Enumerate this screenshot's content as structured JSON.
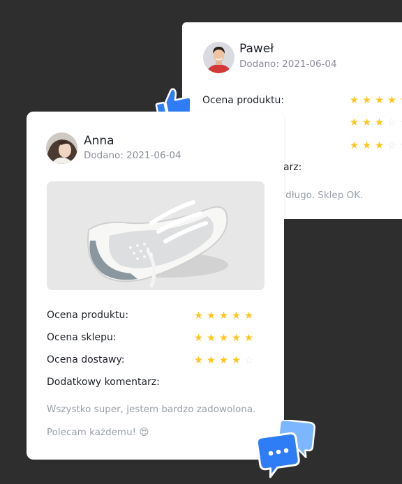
{
  "back_review": {
    "name": "Paweł",
    "date": "Dodano: 2021-06-04",
    "ratings": [
      {
        "label": "Ocena produktu:",
        "stars": 5
      },
      {
        "label": "",
        "stars": 3
      },
      {
        "label": "",
        "stars": 3
      }
    ],
    "comment_label_fragment": "entarz:",
    "comment_fragment": "pyt długo. Sklep OK."
  },
  "front_review": {
    "name": "Anna",
    "date": "Dodano: 2021-06-04",
    "ratings": [
      {
        "label": "Ocena produktu:",
        "stars": 5
      },
      {
        "label": "Ocena sklepu:",
        "stars": 5
      },
      {
        "label": "Ocena dostawy:",
        "stars": 4
      }
    ],
    "comment_label": "Dodatkowy komentarz:",
    "comment_line1": "Wszystko super, jestem bardzo zadowolona.",
    "comment_line2": "Polecam każdemu! 😍"
  },
  "max_stars": 5,
  "colors": {
    "background": "#2e2e2e",
    "star": "#ffc61a",
    "star_empty": "#e2e3e6",
    "accent": "#2f7df6"
  },
  "icons": [
    "thumbs-up-icon",
    "chat-bubble-icon",
    "star-icon"
  ]
}
